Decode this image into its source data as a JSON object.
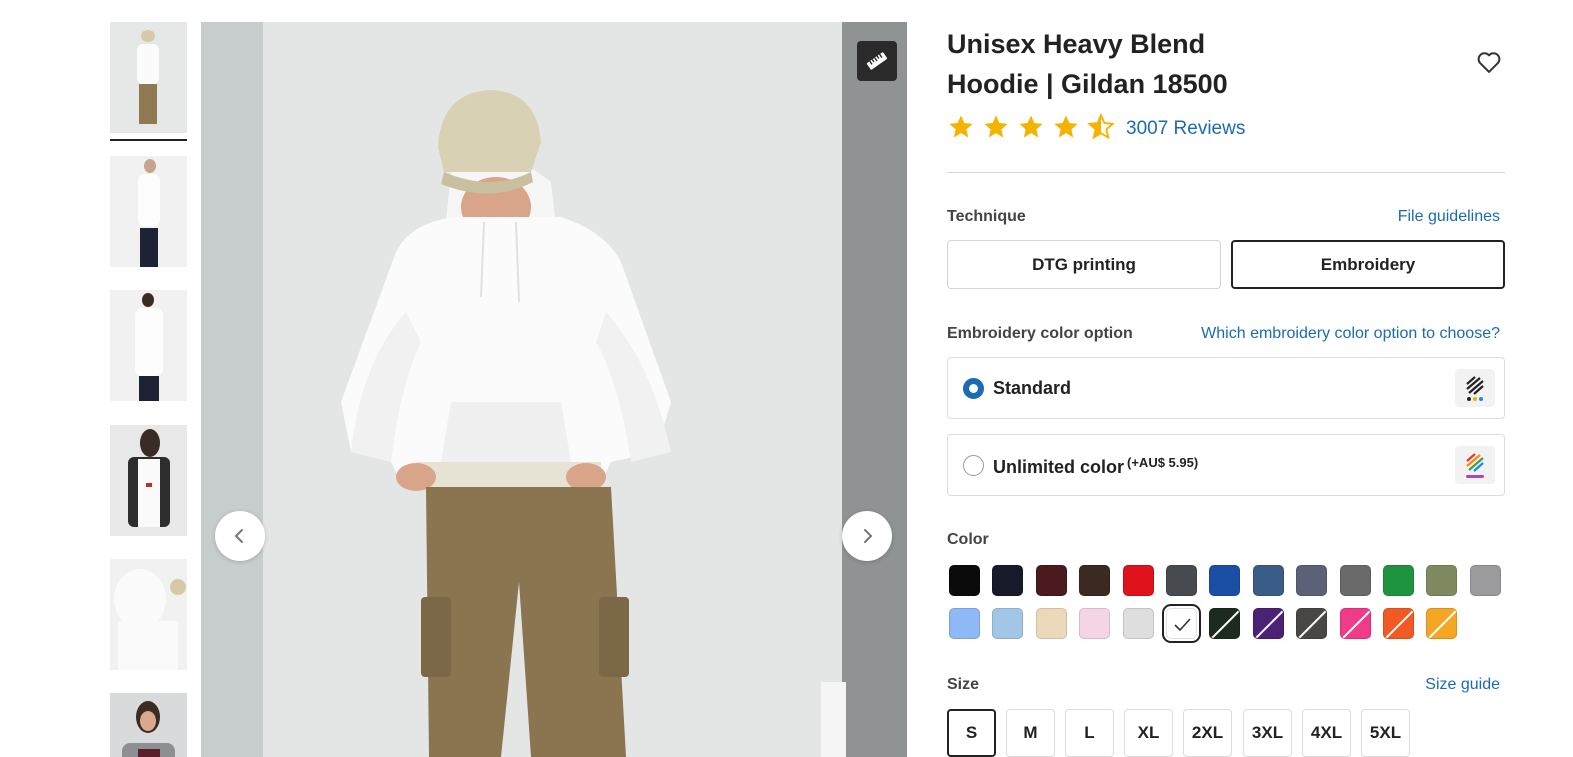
{
  "product": {
    "title_line1": "Unisex Heavy Blend",
    "title_line2": "Hoodie | Gildan 18500",
    "rating": 4.5,
    "reviews_label": "3007 Reviews"
  },
  "thumbnails": [
    {
      "name": "thumb-front-full",
      "selected": true
    },
    {
      "name": "thumb-side"
    },
    {
      "name": "thumb-back"
    },
    {
      "name": "thumb-open-vest"
    },
    {
      "name": "thumb-hood-back"
    },
    {
      "name": "thumb-woman"
    }
  ],
  "technique": {
    "label": "Technique",
    "guidelines_link": "File guidelines",
    "options": [
      "DTG printing",
      "Embroidery"
    ],
    "selected": "Embroidery"
  },
  "embroidery": {
    "label": "Embroidery color option",
    "help_link": "Which embroidery color option to choose?",
    "options": [
      {
        "label": "Standard",
        "extra": "",
        "selected": true
      },
      {
        "label": "Unlimited color",
        "extra": "(+AU$ 5.95)",
        "selected": false
      }
    ]
  },
  "color": {
    "label": "Color",
    "swatches_row1": [
      "#0b0b0b",
      "#161a2b",
      "#4a1a1e",
      "#3a2a22",
      "#e0121b",
      "#474a4f",
      "#1b4fa6",
      "#395d86",
      "#5b6278",
      "#6a6a6a",
      "#1e9440",
      "#7f8a60",
      "#9b9b9d"
    ],
    "swatches_row2": [
      "#8eb8f6",
      "#a3c5e6",
      "#ebd9b9",
      "#f3d5e5",
      "#dedede",
      "#ffffff",
      "#1d2a1f",
      "#4a2276",
      "#4a4644",
      "#f03a8a",
      "#f25a24",
      "#f5a623"
    ],
    "selected_swatch": "#ffffff"
  },
  "size": {
    "label": "Size",
    "guide_link": "Size guide",
    "options": [
      "S",
      "M",
      "L",
      "XL",
      "2XL",
      "3XL",
      "4XL",
      "5XL"
    ],
    "selected": "S"
  },
  "icons": {
    "ruler": "ruler-icon",
    "favorite": "heart-icon",
    "prev": "chevron-left-icon",
    "next": "chevron-right-icon"
  }
}
